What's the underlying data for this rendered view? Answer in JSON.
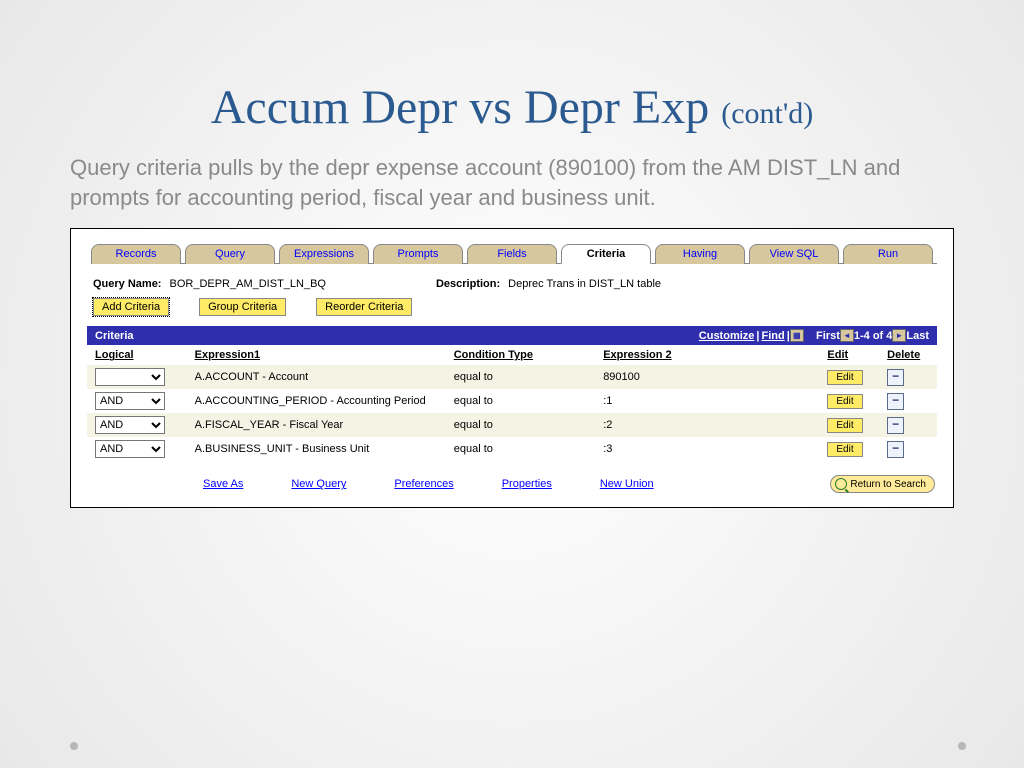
{
  "title_main": "Accum Depr vs Depr Exp ",
  "title_suffix": "(cont'd)",
  "subtitle": "Query criteria pulls by the depr expense account (890100) from the AM DIST_LN and prompts for accounting period, fiscal year and business unit.",
  "tabs": [
    "Records",
    "Query",
    "Expressions",
    "Prompts",
    "Fields",
    "Criteria",
    "Having",
    "View SQL",
    "Run"
  ],
  "active_tab": "Criteria",
  "query_name_label": "Query Name:",
  "query_name_value": "BOR_DEPR_AM_DIST_LN_BQ",
  "description_label": "Description:",
  "description_value": "Deprec Trans in DIST_LN table",
  "buttons": {
    "add": "Add Criteria",
    "group": "Group Criteria",
    "reorder": "Reorder Criteria"
  },
  "bar": {
    "title": "Criteria",
    "customize": "Customize",
    "find": "Find",
    "first": "First",
    "range": "1-4 of 4",
    "last": "Last"
  },
  "headers": {
    "logical": "Logical",
    "expr1": "Expression1",
    "cond": "Condition Type",
    "expr2": "Expression 2",
    "edit": "Edit",
    "del": "Delete"
  },
  "rows": [
    {
      "logical": "",
      "expr1": "A.ACCOUNT - Account",
      "cond": "equal to",
      "expr2": "890100"
    },
    {
      "logical": "AND",
      "expr1": "A.ACCOUNTING_PERIOD - Accounting Period",
      "cond": "equal to",
      "expr2": ":1"
    },
    {
      "logical": "AND",
      "expr1": "A.FISCAL_YEAR - Fiscal Year",
      "cond": "equal to",
      "expr2": ":2"
    },
    {
      "logical": "AND",
      "expr1": "A.BUSINESS_UNIT - Business Unit",
      "cond": "equal to",
      "expr2": ":3"
    }
  ],
  "edit_label": "Edit",
  "footer": {
    "save_as": "Save As",
    "new_query": "New Query",
    "preferences": "Preferences",
    "properties": "Properties",
    "new_union": "New Union",
    "return": "Return to Search"
  }
}
